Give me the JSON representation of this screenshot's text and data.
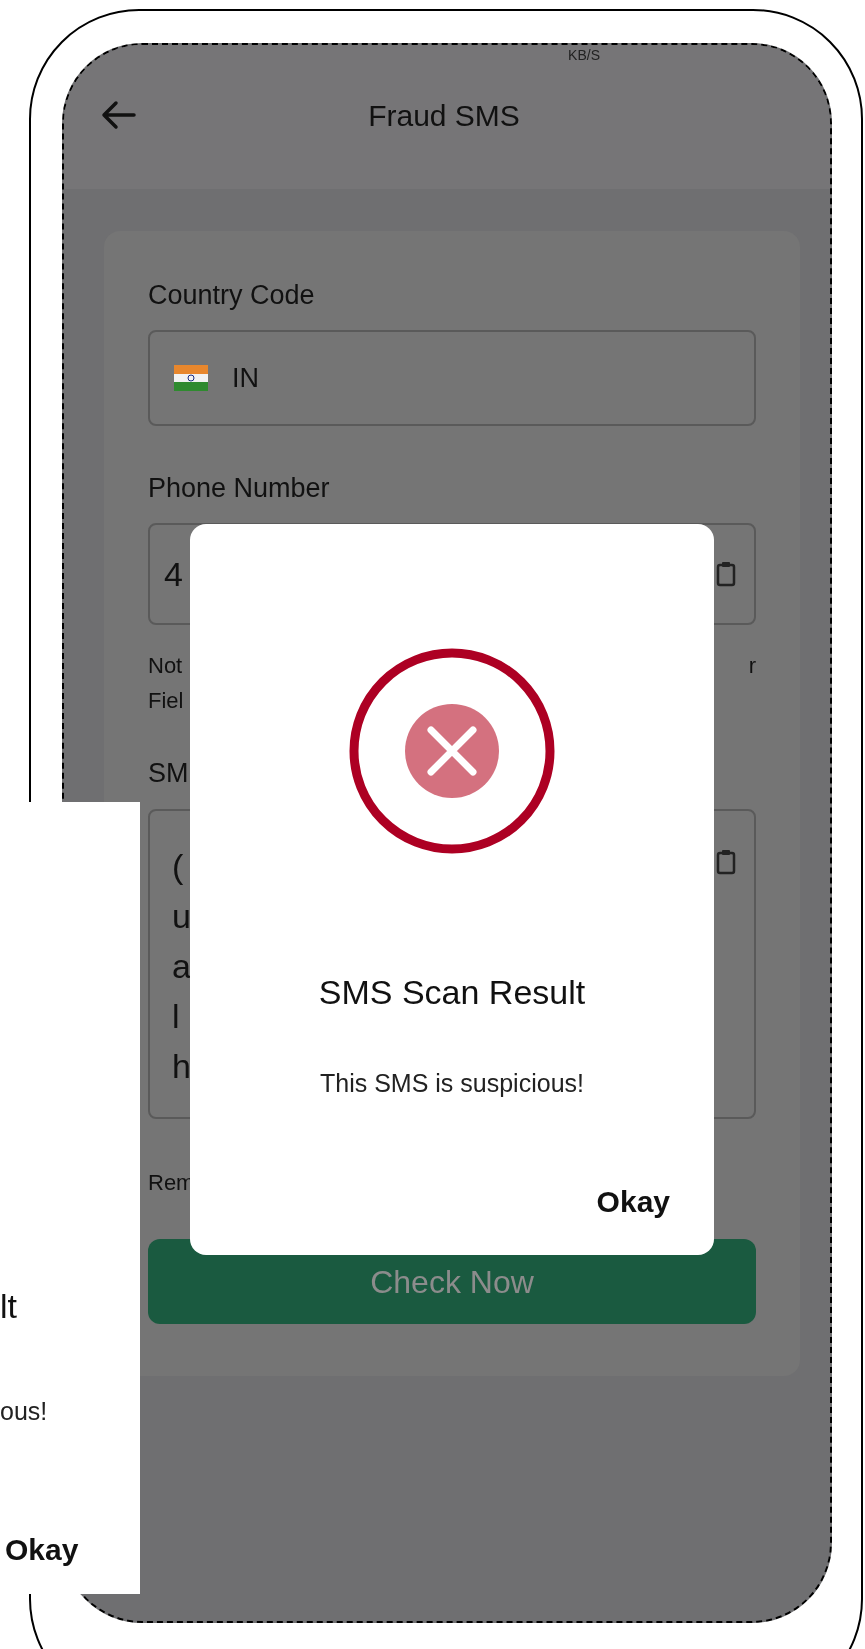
{
  "status_bar": {
    "speed_unit": "KB/S"
  },
  "app_bar": {
    "title": "Fraud SMS"
  },
  "form": {
    "country_code": {
      "label": "Country Code",
      "value": "IN"
    },
    "phone_number": {
      "label": "Phone Number",
      "value": "4"
    },
    "note": {
      "lines": [
        "Not",
        "Fiel"
      ],
      "trailing": "r"
    },
    "sms": {
      "label": "SM",
      "lines": [
        "(",
        "u",
        "a",
        "l",
        "h"
      ]
    },
    "remark": "Rem",
    "check_button": "Check Now"
  },
  "dialog": {
    "title": "SMS Scan Result",
    "message": "This SMS is suspicious!",
    "button": "Okay"
  },
  "dialog_copy": {
    "title": "lt",
    "message": "ous!",
    "button": "Okay"
  }
}
